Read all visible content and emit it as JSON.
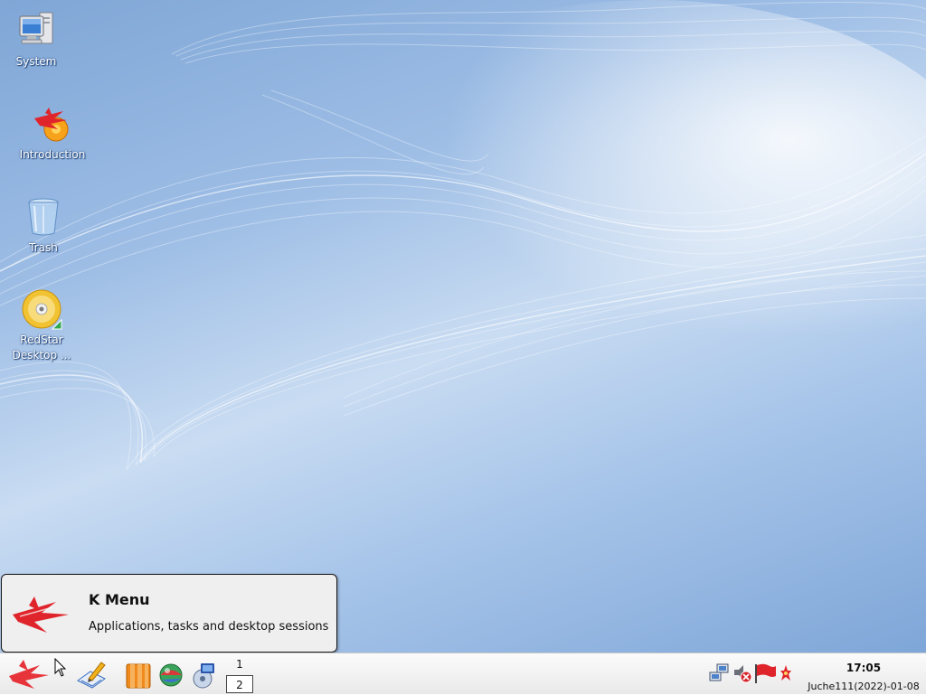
{
  "desktop": {
    "icons": [
      {
        "name": "system-icon",
        "label": "System"
      },
      {
        "name": "introduction-icon",
        "label": "Introduction"
      },
      {
        "name": "trash-icon",
        "label": "Trash"
      },
      {
        "name": "redstar-desktop-icon",
        "label": "RedStar Desktop ..."
      }
    ]
  },
  "tooltip": {
    "title": "K Menu",
    "description": "Applications, tasks and desktop sessions"
  },
  "taskbar": {
    "pager": {
      "desktops": [
        "1",
        "2"
      ],
      "active": "2"
    },
    "clock": {
      "time": "17:05",
      "date": "Juche111(2022)-01-08"
    },
    "launchers": [
      "kmenu-icon",
      "text-editor-icon",
      "office-icon",
      "web-browser-icon",
      "media-player-icon"
    ],
    "tray": [
      "network-icon",
      "volume-muted-icon",
      "flag-icon",
      "notification-icon"
    ]
  },
  "colors": {
    "wallpaper_light": "#e6effa",
    "wallpaper_dark": "#7ea6d8",
    "accent_red": "#e0242b",
    "tooltip_bg": "#efefef"
  }
}
